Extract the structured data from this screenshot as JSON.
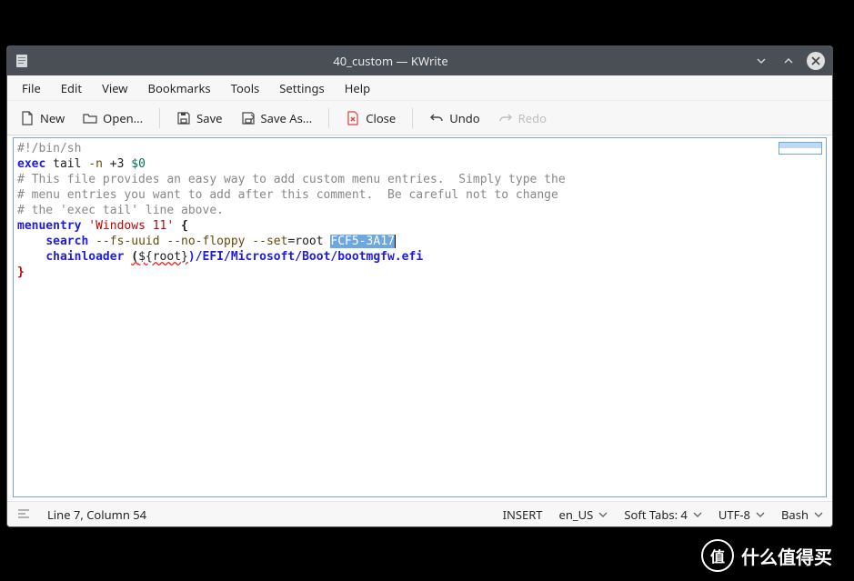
{
  "window": {
    "title": "40_custom — KWrite"
  },
  "menu": {
    "file": "File",
    "edit": "Edit",
    "view": "View",
    "bookmarks": "Bookmarks",
    "tools": "Tools",
    "settings": "Settings",
    "help": "Help"
  },
  "toolbar": {
    "new": "New",
    "open": "Open...",
    "save": "Save",
    "save_as": "Save As...",
    "close": "Close",
    "undo": "Undo",
    "redo": "Redo"
  },
  "code": {
    "l1_shebang": "#!/bin/sh",
    "l2_exec": "exec",
    "l2_tail": " tail ",
    "l2_flag": "-n",
    "l2_num": " +3 ",
    "l2_arg": "$0",
    "l3": "# This file provides an easy way to add custom menu entries.  Simply type the",
    "l4": "# menu entries you want to add after this comment.  Be careful not to change",
    "l5": "# the 'exec tail' line above.",
    "l6_kw": "menuentry",
    "l6_str": " 'Windows 11' ",
    "l6_brace": "{",
    "l7_indent": "    ",
    "l7_search": "search",
    "l7_opts": " --fs-uuid --no-floppy --set",
    "l7_eqroot": "=root ",
    "l7_uuid": "FCF5-3A17",
    "l8_indent": "    ",
    "l8_chain": "chainloader ",
    "l8_paren": "(",
    "l8_root": "${root}",
    "l8_cparen": ")",
    "l8_path": "/EFI/Microsoft/Boot/bootmgfw.efi",
    "l9_brace": "}"
  },
  "status": {
    "position": "Line 7, Column 54",
    "mode": "INSERT",
    "lang": "en_US",
    "indent": "Soft Tabs: 4",
    "encoding": "UTF-8",
    "syntax": "Bash"
  },
  "brand": {
    "glyph": "值",
    "text": "什么值得买"
  }
}
